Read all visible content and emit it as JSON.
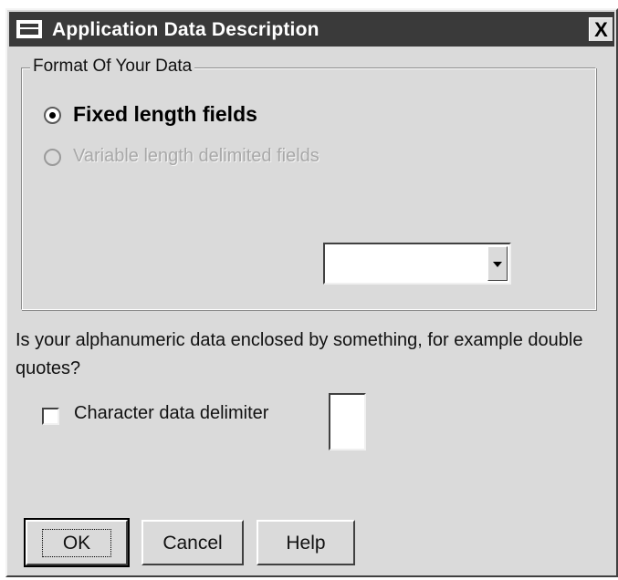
{
  "window": {
    "title": "Application Data Description",
    "close_label": "X"
  },
  "format_group": {
    "legend": "Format Of Your Data",
    "options": [
      {
        "label": "Fixed length fields",
        "selected": true,
        "enabled": true
      },
      {
        "label": "Variable length delimited fields",
        "selected": false,
        "enabled": false
      }
    ],
    "combo_value": ""
  },
  "delimiter": {
    "question": "Is your alphanumeric data enclosed by something, for example double quotes?",
    "checkbox_label": "Character data delimiter",
    "checked": false,
    "value": ""
  },
  "buttons": {
    "ok": "OK",
    "cancel": "Cancel",
    "help": "Help"
  },
  "icons": {
    "title_icon": "window-menu-icon",
    "close_icon": "close-icon",
    "combo_icon": "chevron-down-icon"
  }
}
